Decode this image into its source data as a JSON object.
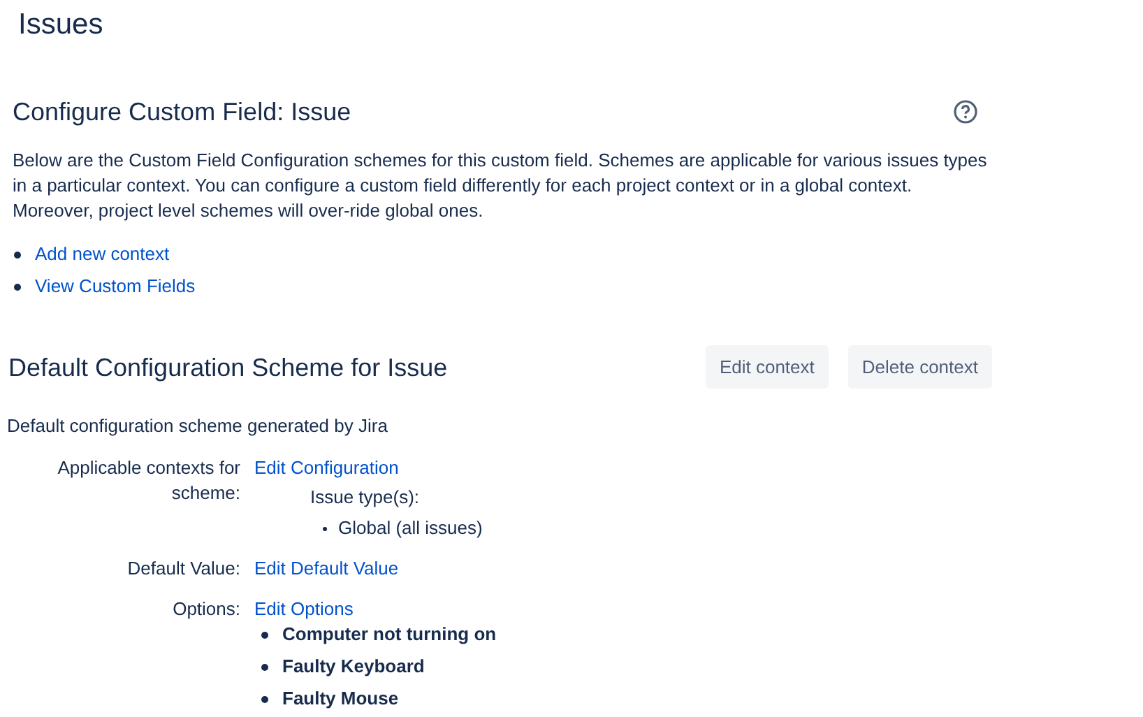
{
  "page_title": "Issues",
  "section": {
    "title": "Configure Custom Field: Issue",
    "description": "Below are the Custom Field Configuration schemes for this custom field. Schemes are applicable for various issues types in a particular context. You can configure a custom field differently for each project context or in a global context. Moreover, project level schemes will over-ride global ones.",
    "links": [
      "Add new context",
      "View Custom Fields"
    ]
  },
  "scheme": {
    "title": "Default Configuration Scheme for Issue",
    "buttons": [
      "Edit context",
      "Delete context"
    ],
    "description": "Default configuration scheme generated by Jira",
    "contexts": {
      "label": "Applicable contexts for scheme:",
      "link": "Edit Configuration",
      "issue_types_label": "Issue type(s):",
      "issue_types": [
        "Global (all issues)"
      ]
    },
    "default_value": {
      "label": "Default Value:",
      "link": "Edit Default Value"
    },
    "options": {
      "label": "Options:",
      "link": "Edit Options",
      "items": [
        "Computer not turning on",
        "Faulty Keyboard",
        "Faulty Mouse"
      ]
    }
  }
}
